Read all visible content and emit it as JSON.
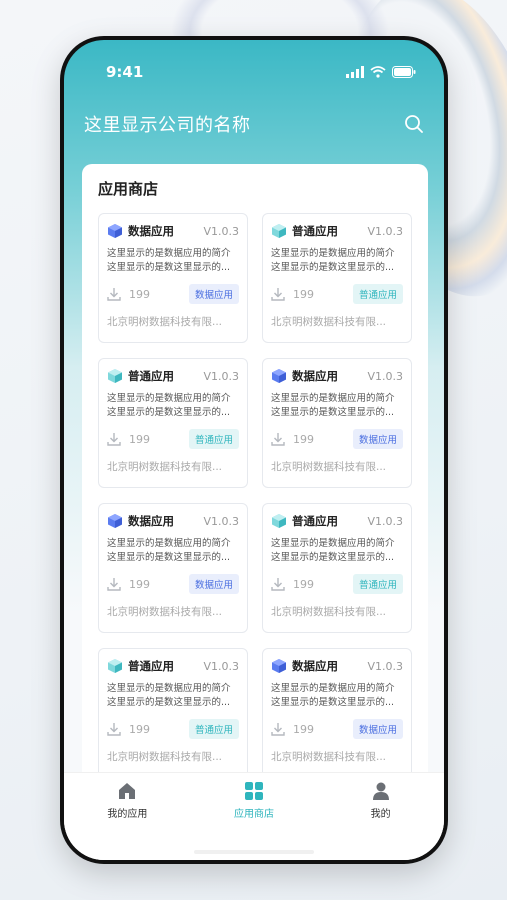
{
  "status": {
    "time": "9:41"
  },
  "header": {
    "company_name": "这里显示公司的名称"
  },
  "store": {
    "title": "应用商店",
    "apps": [
      {
        "icon": "data-app-icon",
        "name": "数据应用",
        "version": "V1.0.3",
        "desc": "这里显示的是数据应用的简介这里显示的是数这里显示的...",
        "downloads": "199",
        "tag": "数据应用",
        "type": "data",
        "company": "北京明树数据科技有限..."
      },
      {
        "icon": "normal-app-icon",
        "name": "普通应用",
        "version": "V1.0.3",
        "desc": "这里显示的是数据应用的简介这里显示的是数这里显示的...",
        "downloads": "199",
        "tag": "普通应用",
        "type": "normal",
        "company": "北京明树数据科技有限..."
      },
      {
        "icon": "normal-app-icon",
        "name": "普通应用",
        "version": "V1.0.3",
        "desc": "这里显示的是数据应用的简介这里显示的是数这里显示的...",
        "downloads": "199",
        "tag": "普通应用",
        "type": "normal",
        "company": "北京明树数据科技有限..."
      },
      {
        "icon": "data-app-icon",
        "name": "数据应用",
        "version": "V1.0.3",
        "desc": "这里显示的是数据应用的简介这里显示的是数这里显示的...",
        "downloads": "199",
        "tag": "数据应用",
        "type": "data",
        "company": "北京明树数据科技有限..."
      },
      {
        "icon": "data-app-icon",
        "name": "数据应用",
        "version": "V1.0.3",
        "desc": "这里显示的是数据应用的简介这里显示的是数这里显示的...",
        "downloads": "199",
        "tag": "数据应用",
        "type": "data",
        "company": "北京明树数据科技有限..."
      },
      {
        "icon": "normal-app-icon",
        "name": "普通应用",
        "version": "V1.0.3",
        "desc": "这里显示的是数据应用的简介这里显示的是数这里显示的...",
        "downloads": "199",
        "tag": "普通应用",
        "type": "normal",
        "company": "北京明树数据科技有限..."
      },
      {
        "icon": "normal-app-icon",
        "name": "普通应用",
        "version": "V1.0.3",
        "desc": "这里显示的是数据应用的简介这里显示的是数这里显示的...",
        "downloads": "199",
        "tag": "普通应用",
        "type": "normal",
        "company": "北京明树数据科技有限..."
      },
      {
        "icon": "data-app-icon",
        "name": "数据应用",
        "version": "V1.0.3",
        "desc": "这里显示的是数据应用的简介这里显示的是数这里显示的...",
        "downloads": "199",
        "tag": "数据应用",
        "type": "data",
        "company": "北京明树数据科技有限..."
      }
    ]
  },
  "tabbar": {
    "items": [
      {
        "label": "我的应用",
        "icon": "home-icon",
        "active": false
      },
      {
        "label": "应用商店",
        "icon": "grid-icon",
        "active": true
      },
      {
        "label": "我的",
        "icon": "user-icon",
        "active": false
      }
    ]
  },
  "colors": {
    "accent": "#2fb5bd",
    "data_tag": "#4a6ee0"
  }
}
